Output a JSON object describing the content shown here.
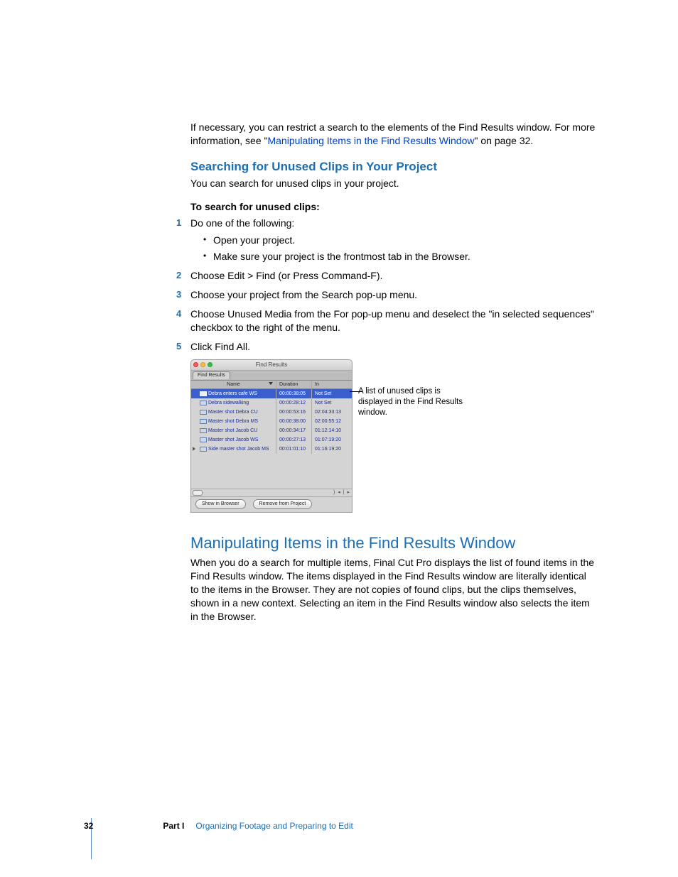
{
  "intro": {
    "p1a": "If necessary, you can restrict a search to the elements of the Find Results window. For more information, see \"",
    "p1_link": "Manipulating Items in the Find Results Window",
    "p1b": "\" on page 32."
  },
  "section1": {
    "heading": "Searching for Unused Clips in Your Project",
    "lead": "You can search for unused clips in your project.",
    "task": "To search for unused clips:",
    "steps": [
      {
        "num": "1",
        "text": "Do one of the following:",
        "subs": [
          "Open your project.",
          "Make sure your project is the frontmost tab in the Browser."
        ]
      },
      {
        "num": "2",
        "text": "Choose Edit > Find (or Press Command-F)."
      },
      {
        "num": "3",
        "text": "Choose your project from the Search pop-up menu."
      },
      {
        "num": "4",
        "text": "Choose Unused Media from the For pop-up menu and deselect the \"in selected sequences\" checkbox to the right of the menu."
      },
      {
        "num": "5",
        "text": "Click Find All."
      }
    ]
  },
  "find_results": {
    "title": "Find Results",
    "tab": "Find Results",
    "cols": {
      "name": "Name",
      "duration": "Duration",
      "in": "In"
    },
    "rows": [
      {
        "name": "Debra enters cafe WS",
        "duration": "00:00:38:05",
        "in": "Not Set",
        "selected": true
      },
      {
        "name": "Debra sidewalking",
        "duration": "00:00:28:12",
        "in": "Not Set"
      },
      {
        "name": "Master shot Debra CU",
        "duration": "00:00:53:16",
        "in": "02:04:33:13"
      },
      {
        "name": "Master shot Debra MS",
        "duration": "00:00:38:00",
        "in": "02:00:55:12"
      },
      {
        "name": "Master shot Jacob CU",
        "duration": "00:00:34:17",
        "in": "01:12:14:10"
      },
      {
        "name": "Master shot Jacob WS",
        "duration": "00:00:27:13",
        "in": "01:07:19:20"
      },
      {
        "name": "Side master shot Jacob MS",
        "duration": "00:01:01:10",
        "in": "01:16:19:20",
        "last": true
      }
    ],
    "btn_show": "Show in Browser",
    "btn_remove": "Remove from Project",
    "annotation": "A list of unused clips is displayed in the Find Results window."
  },
  "section2": {
    "heading": "Manipulating Items in the Find Results Window",
    "body": "When you do a search for multiple items, Final Cut Pro displays the list of found items in the Find Results window. The items displayed in the Find Results window are literally identical to the items in the Browser. They are not copies of found clips, but the clips themselves, shown in a new context. Selecting an item in the Find Results window also selects the item in the Browser."
  },
  "footer": {
    "page": "32",
    "part": "Part I",
    "title": "Organizing Footage and Preparing to Edit"
  }
}
